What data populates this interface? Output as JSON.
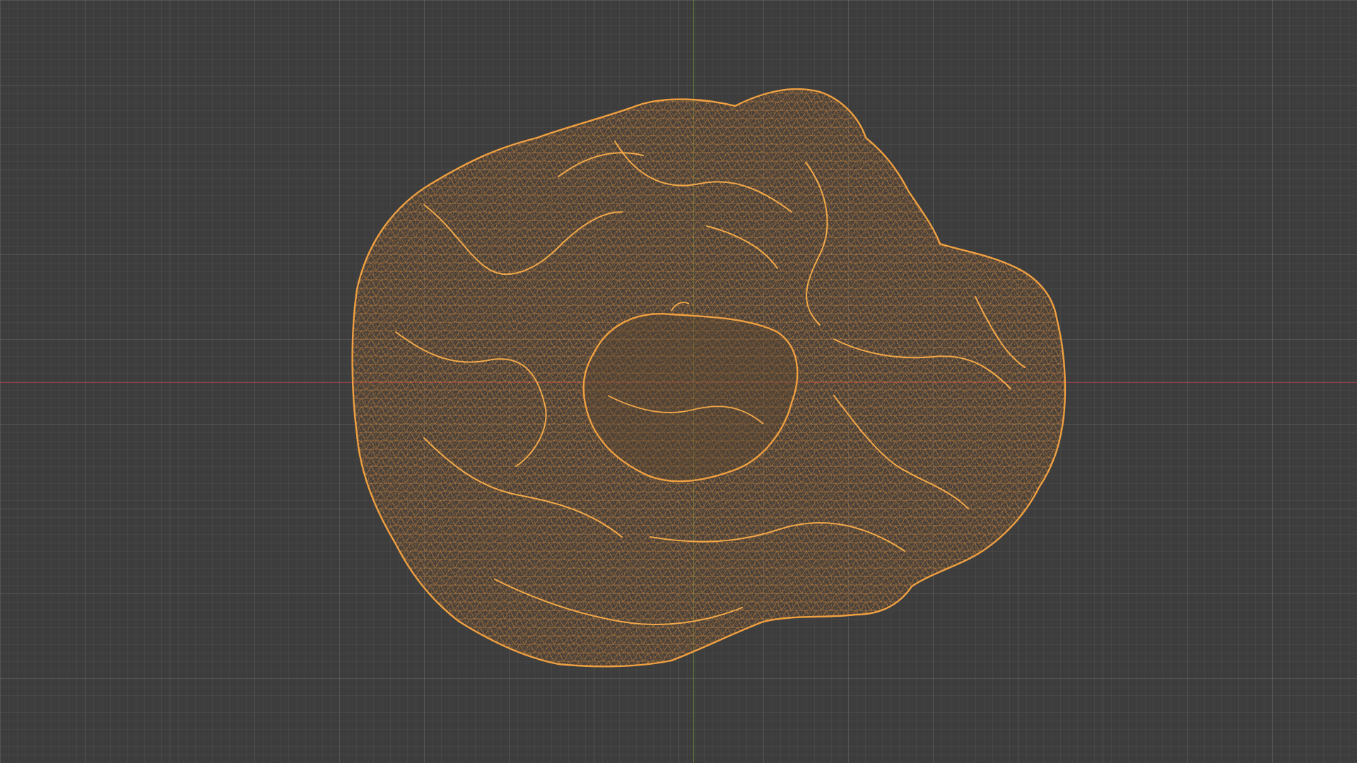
{
  "viewport": {
    "background_color": "#3d3d3d",
    "grid_color": "#4a4a4a",
    "x_axis_color": "#b24650",
    "y_axis_color": "#6a9a3c"
  },
  "object": {
    "display_mode": "wireframe",
    "wire_color": "#e8923a",
    "selected": true
  }
}
